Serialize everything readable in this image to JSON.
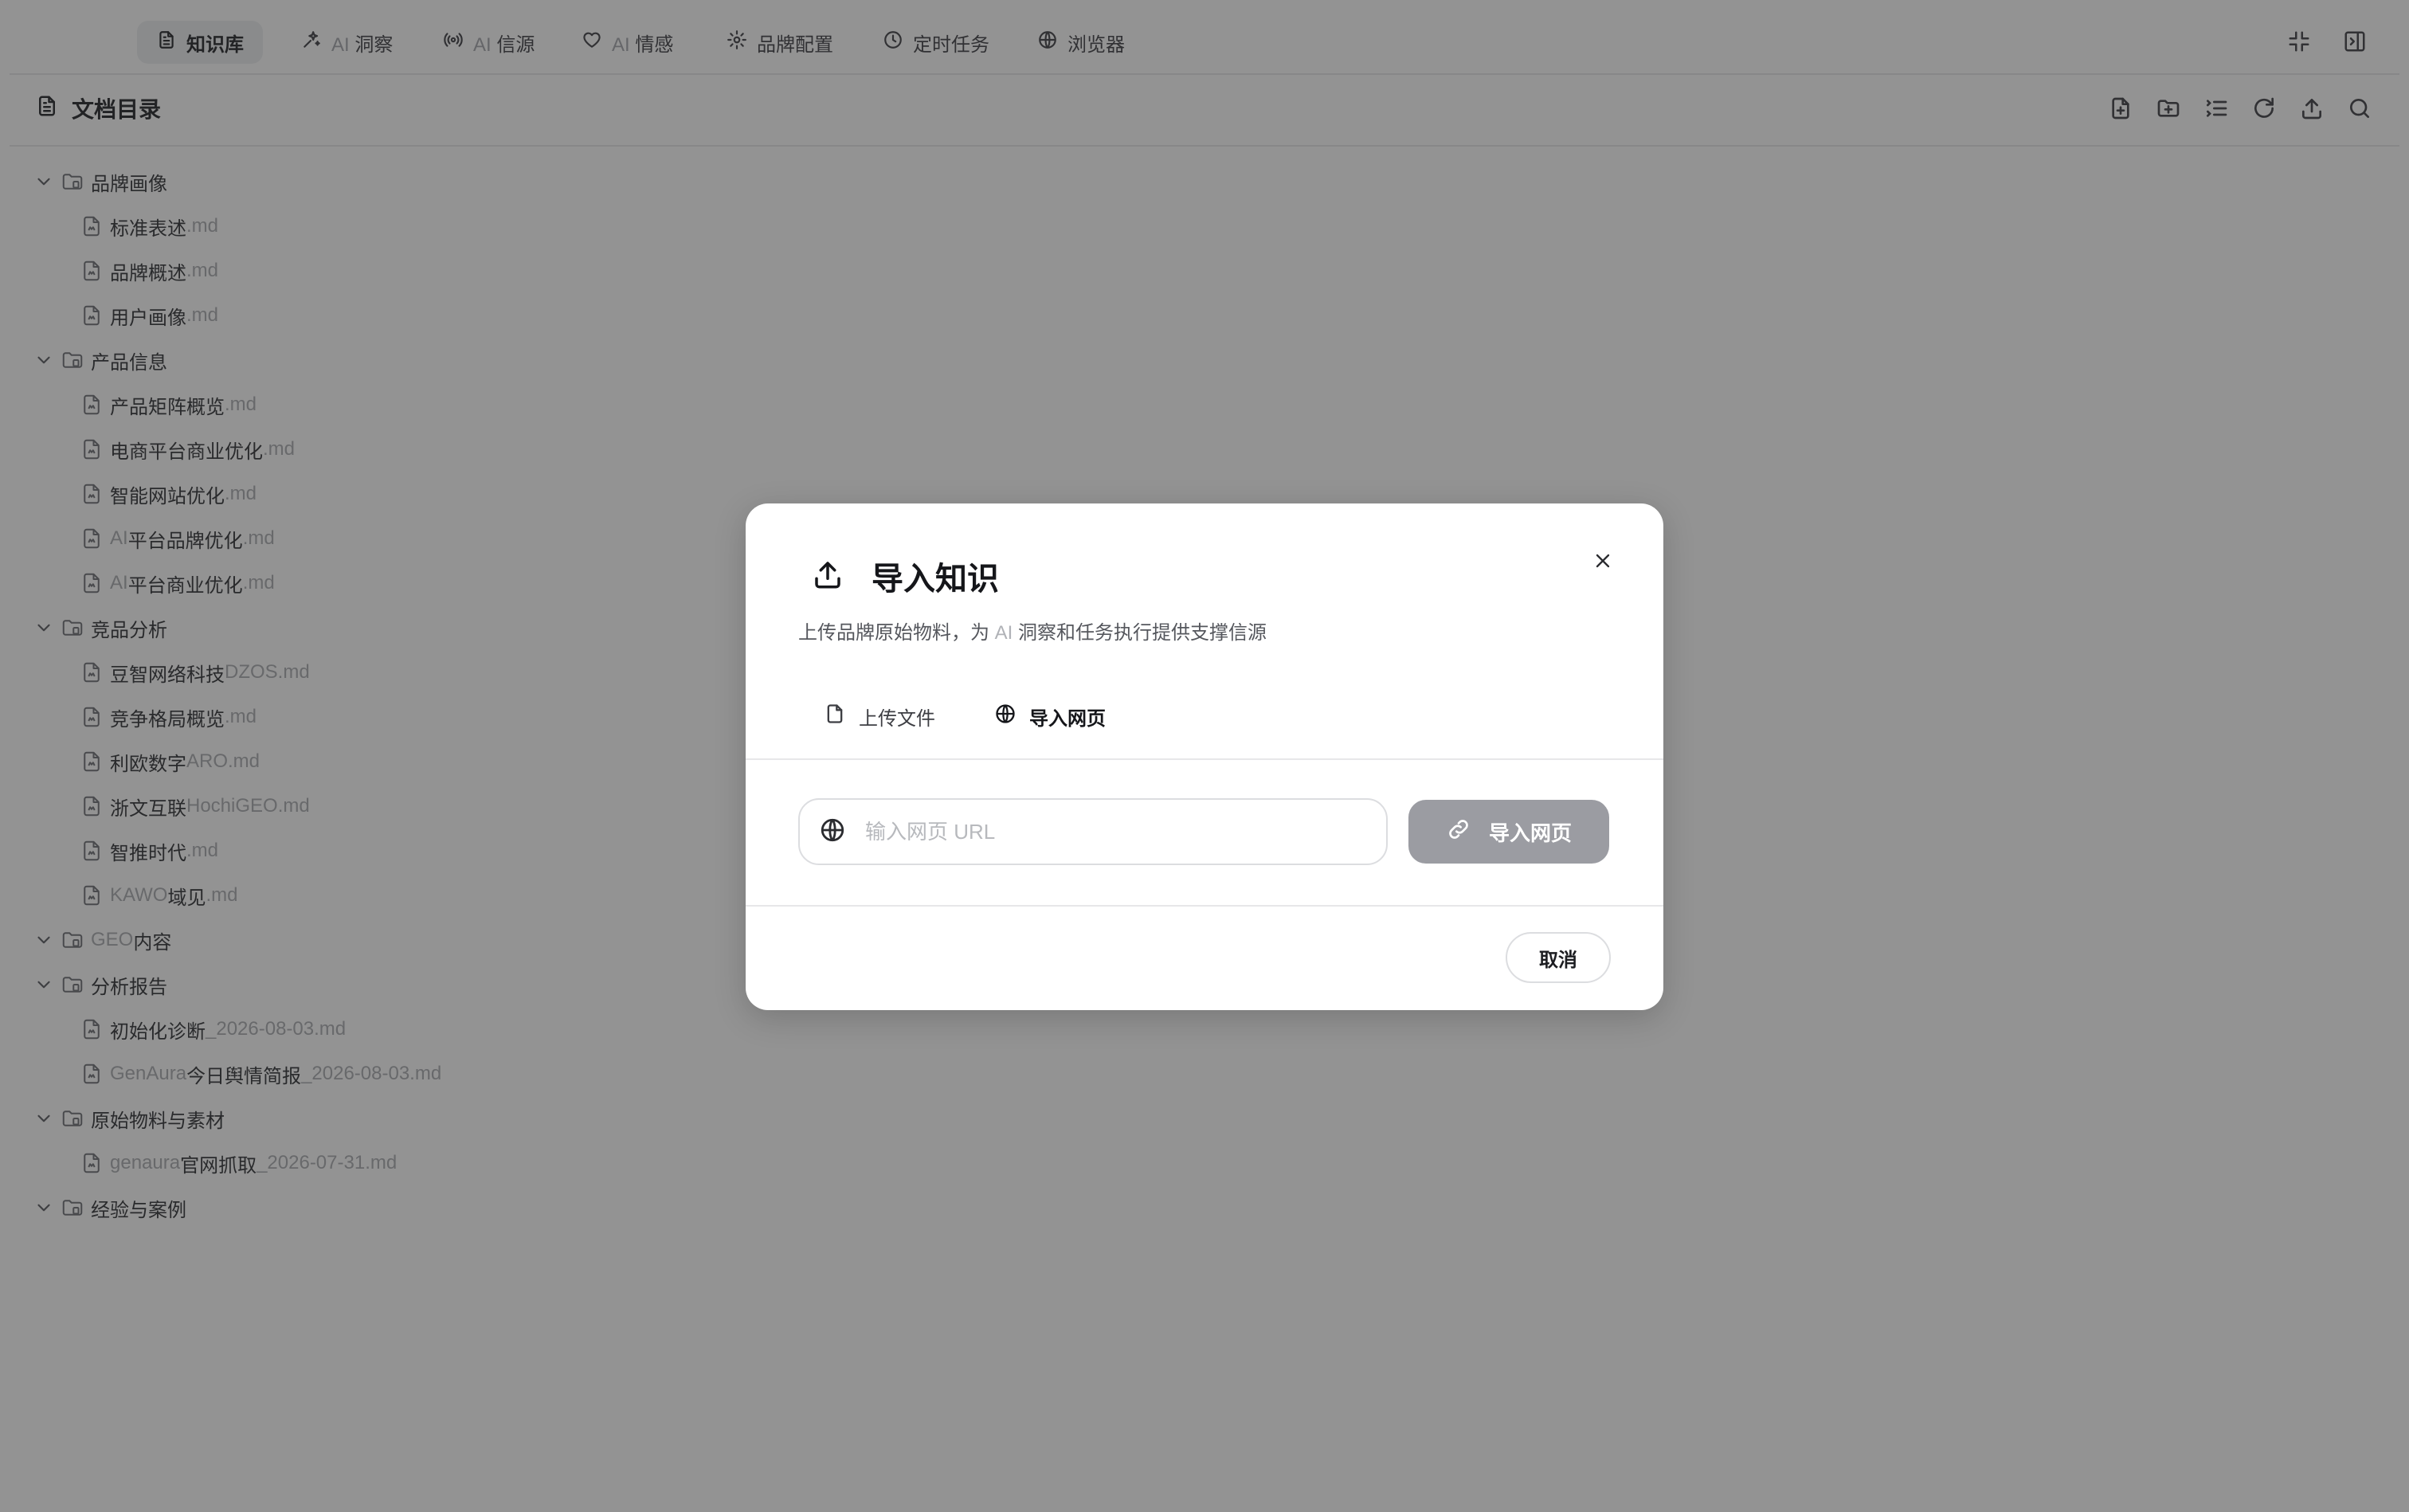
{
  "nav": {
    "tabs": [
      {
        "icon": "file-text-icon",
        "prefix": "",
        "label": "知识库",
        "active": true
      },
      {
        "icon": "sparkles-icon",
        "prefix": "AI",
        "label": "洞察",
        "active": false
      },
      {
        "icon": "radio-signal-icon",
        "prefix": "AI",
        "label": "信源",
        "active": false
      },
      {
        "icon": "heart-icon",
        "prefix": "AI",
        "label": "情感",
        "active": false
      },
      {
        "icon": "gear-icon",
        "prefix": "",
        "label": "品牌配置",
        "active": false
      },
      {
        "icon": "clock-icon",
        "prefix": "",
        "label": "定时任务",
        "active": false
      },
      {
        "icon": "globe-icon",
        "prefix": "",
        "label": "浏览器",
        "active": false
      }
    ]
  },
  "subheader": {
    "title": "文档目录"
  },
  "tree": [
    {
      "type": "folder",
      "name": "品牌画像"
    },
    {
      "type": "file",
      "name": "标准表述",
      "ext": ".md"
    },
    {
      "type": "file",
      "name": "品牌概述",
      "ext": ".md"
    },
    {
      "type": "file",
      "name": "用户画像",
      "ext": ".md"
    },
    {
      "type": "folder",
      "name": "产品信息"
    },
    {
      "type": "file",
      "name": "产品矩阵概览",
      "ext": ".md"
    },
    {
      "type": "file",
      "name": "电商平台商业优化",
      "ext": ".md"
    },
    {
      "type": "file",
      "name": "智能网站优化",
      "ext": ".md"
    },
    {
      "type": "file",
      "pre": "AI",
      "name": "平台品牌优化",
      "ext": ".md"
    },
    {
      "type": "file",
      "pre": "AI",
      "name": "平台商业优化",
      "ext": ".md"
    },
    {
      "type": "folder",
      "name": "竞品分析"
    },
    {
      "type": "file",
      "name": "豆智网络科技",
      "ext": "DZOS.md"
    },
    {
      "type": "file",
      "name": "竞争格局概览",
      "ext": ".md"
    },
    {
      "type": "file",
      "name": "利欧数字",
      "ext": "ARO.md"
    },
    {
      "type": "file",
      "name": "浙文互联",
      "ext": "HochiGEO.md"
    },
    {
      "type": "file",
      "name": "智推时代",
      "ext": ".md"
    },
    {
      "type": "file",
      "pre": "KAWO",
      "name": "域见",
      "ext": ".md"
    },
    {
      "type": "folder",
      "pre": "GEO ",
      "name": "内容"
    },
    {
      "type": "folder",
      "name": "分析报告"
    },
    {
      "type": "file",
      "name": "初始化诊断",
      "ext": "_2026-08-03.md"
    },
    {
      "type": "file",
      "pre": "GenAura",
      "name": "今日舆情简报",
      "ext": "_2026-08-03.md"
    },
    {
      "type": "folder",
      "name": "原始物料与素材"
    },
    {
      "type": "file",
      "pre": "genaura",
      "name": "官网抓取",
      "ext": "_2026-07-31.md"
    },
    {
      "type": "folder",
      "name": "经验与案例"
    }
  ],
  "modal": {
    "title": "导入知识",
    "desc_before": "上传品牌原始物料，为 ",
    "desc_ai": "AI",
    "desc_after": " 洞察和任务执行提供支撑信源",
    "tab_upload": "上传文件",
    "tab_web": "导入网页",
    "url_placeholder": "输入网页 URL",
    "import_button": "导入网页",
    "cancel_button": "取消"
  }
}
